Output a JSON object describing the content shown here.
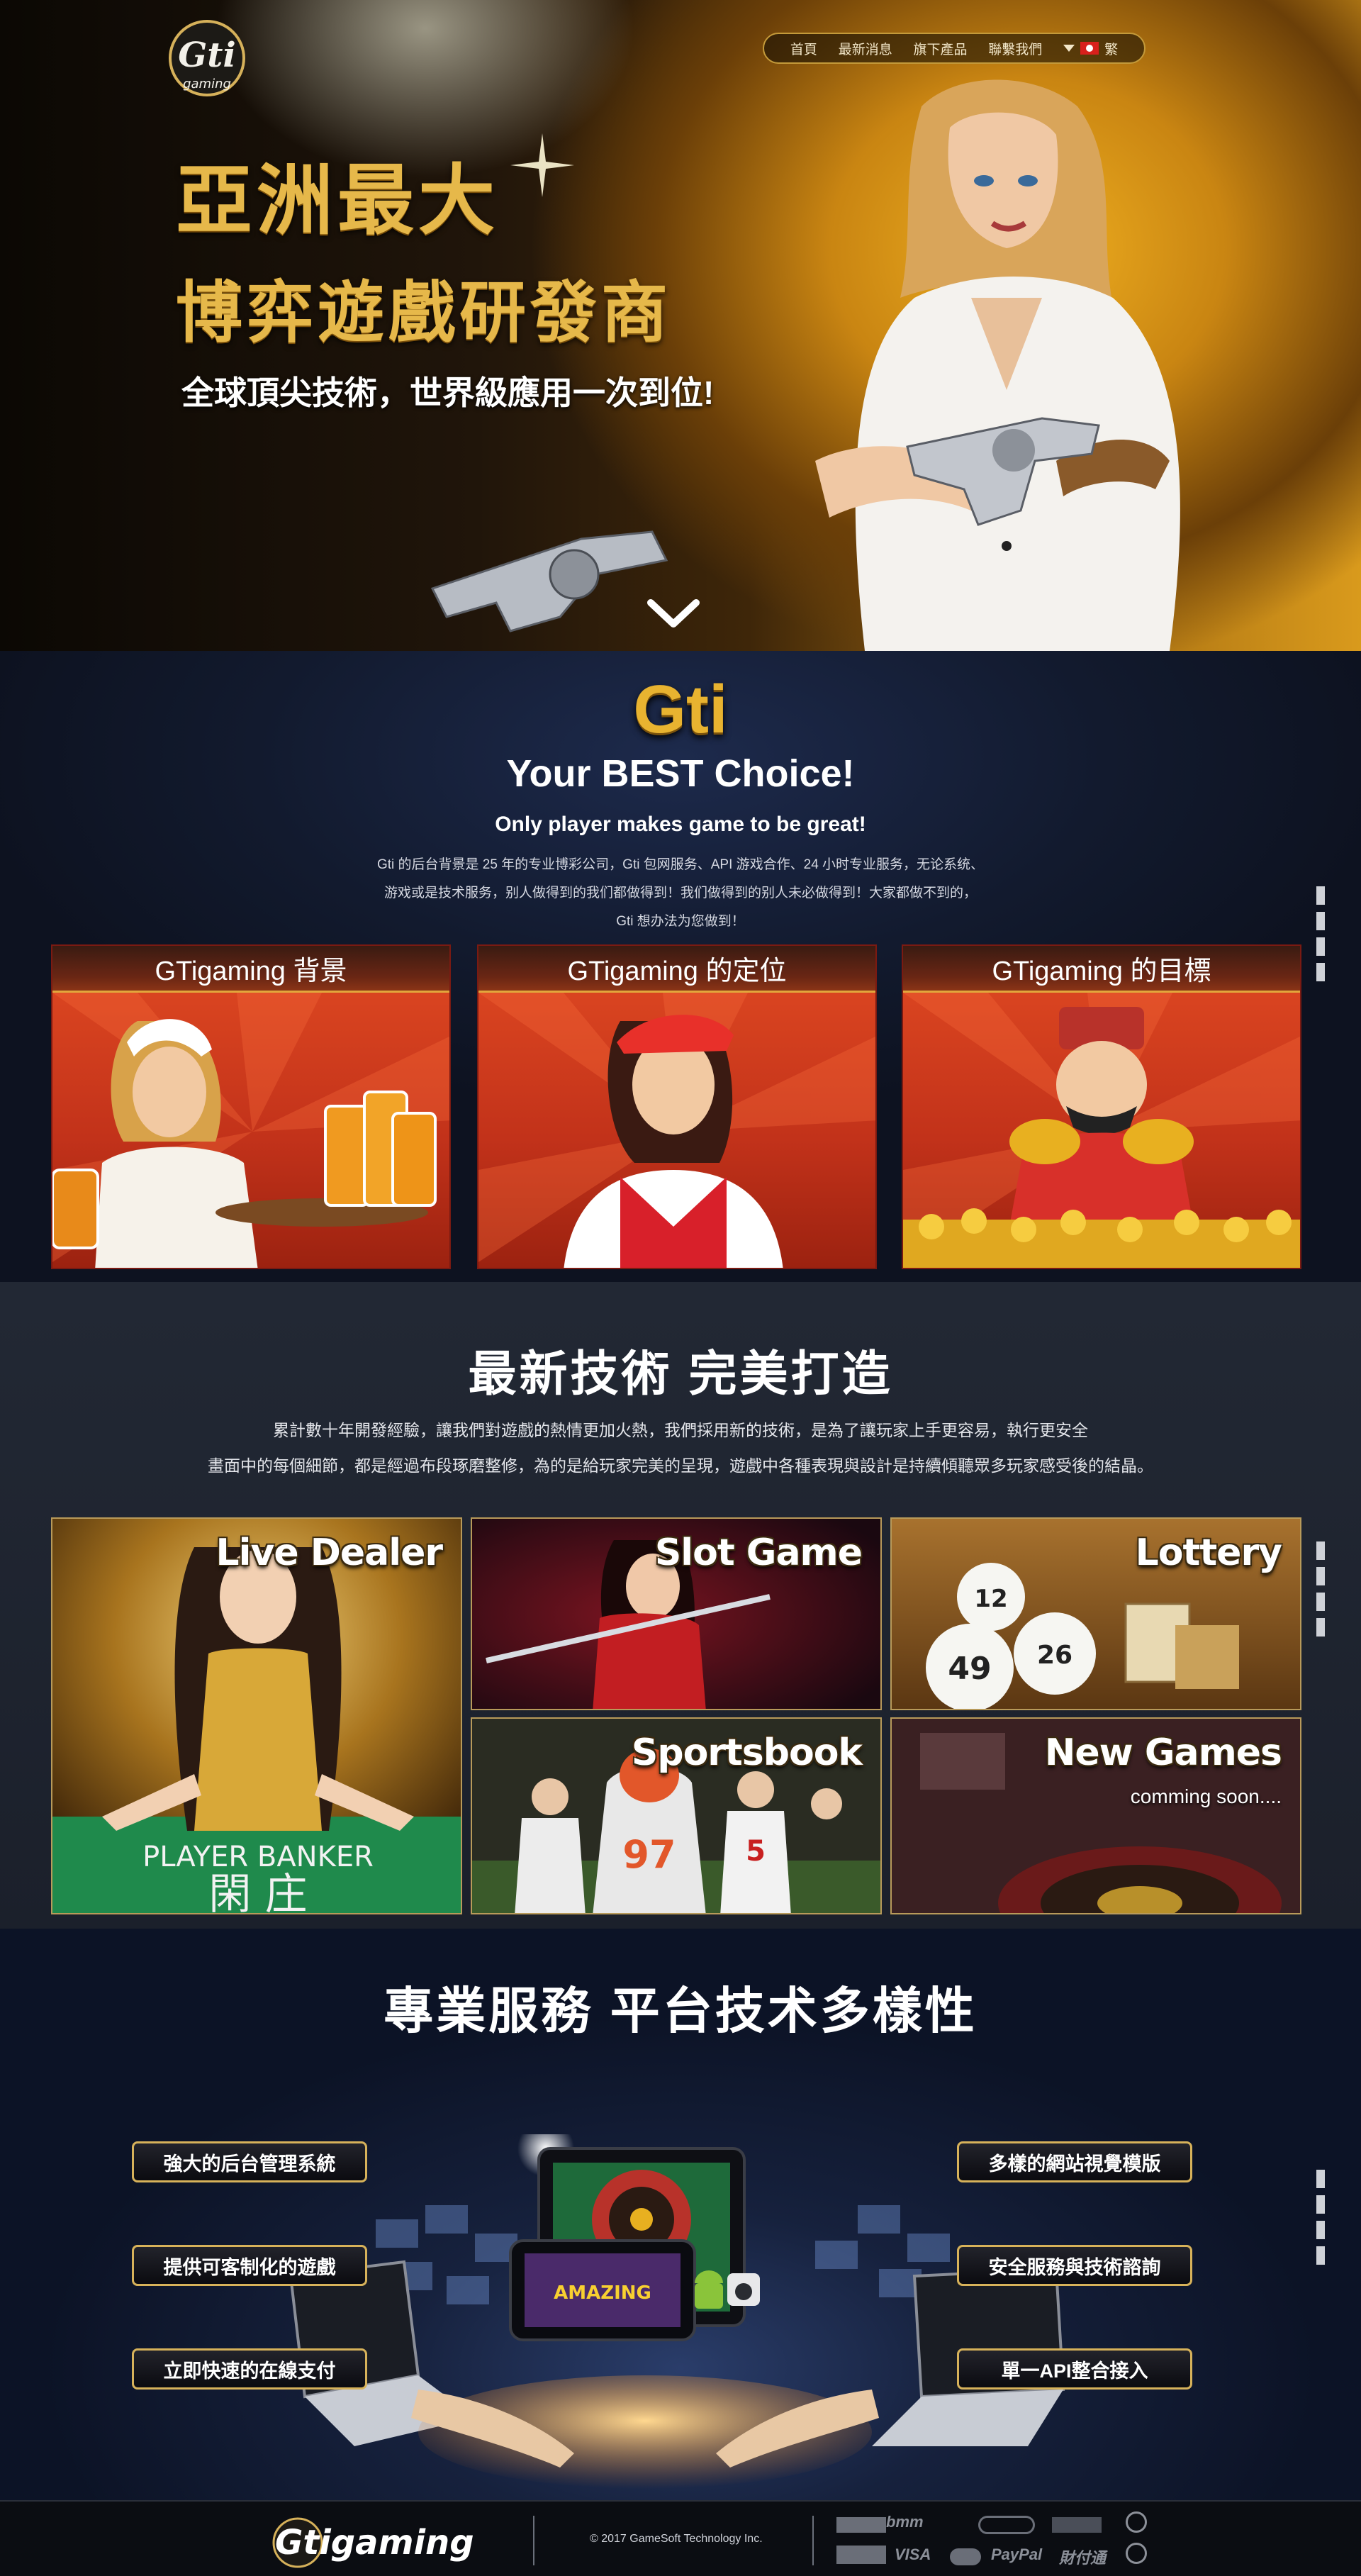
{
  "hero": {
    "nav": {
      "items": [
        "首頁",
        "最新消息",
        "旗下產品",
        "聯繫我們"
      ],
      "lang_label": "繁"
    },
    "logo_text": "Gti",
    "logo_sub": "gaming",
    "headline_line1": "亞洲最大",
    "headline_line2": "博弈遊戲研發商",
    "tagline": "全球頂尖技術，世界級應用一次到位!"
  },
  "intro": {
    "brand": "Gti",
    "title": "Your BEST Choice!",
    "subtitle": "Only player makes game to be great!",
    "lines": [
      "Gti 的后台背景是 25 年的专业博彩公司，Gti 包网服务、API 游戏合作、24 小时专业服务，无论系统、",
      "游戏或是技术服务，别人做得到的我们都做得到！我们做得到的别人未必做得到！大家都做不到的，",
      "Gti 想办法为您做到！"
    ],
    "cards": [
      {
        "title": "GTigaming 背景"
      },
      {
        "title": "GTigaming 的定位"
      },
      {
        "title": "GTigaming 的目標"
      }
    ]
  },
  "tech": {
    "title": "最新技術 完美打造",
    "lines": [
      "累計數十年開發經驗，讓我們對遊戲的熱情更加火熱，我們採用新的技術，是為了讓玩家上手更容易，執行更安全",
      "畫面中的每個細節，都是經過布段琢磨整修，為的是給玩家完美的呈現，遊戲中各種表現與設計是持續傾聽眾多玩家感受後的結晶。"
    ],
    "tiles": {
      "live": {
        "label": "Live Dealer",
        "table_text": "PLAYER BANKER",
        "table_cn": "閑 庄"
      },
      "slot": {
        "label": "Slot Game"
      },
      "lottery": {
        "label": "Lottery",
        "balls": [
          "12",
          "26",
          "49"
        ]
      },
      "sports": {
        "label": "Sportsbook",
        "jersey1": "97",
        "jersey2": "5"
      },
      "newgames": {
        "label": "New Games",
        "sub": "comming soon...."
      }
    }
  },
  "services": {
    "title": "專業服務  平台技术多樣性",
    "left": [
      "強大的后台管理系統",
      "提供可客制化的遊戲",
      "立即快速的在線支付"
    ],
    "right": [
      "多樣的網站視覺模版",
      "安全服務與技術諮詢",
      "單一API整合接入"
    ],
    "phone_text": "AMAZING"
  },
  "footer": {
    "logo": "Gtigaming",
    "copyright": "© 2017 GameSoft Technology Inc.",
    "payments": [
      "bmm",
      "VISA",
      "PayPal",
      "財付通"
    ]
  },
  "colors": {
    "gold": "#e6b84a",
    "card_red": "#c2321a",
    "pill_border": "#d7b25a",
    "navy": "#121a2e"
  }
}
